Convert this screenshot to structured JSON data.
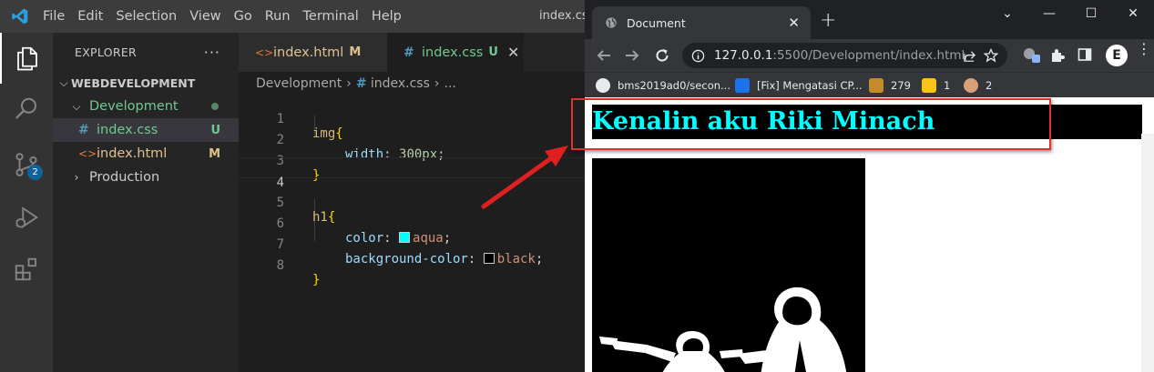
{
  "vscode": {
    "menu": [
      "File",
      "Edit",
      "Selection",
      "View",
      "Go",
      "Run",
      "Terminal",
      "Help"
    ],
    "window_title": "index.cs",
    "scm_badge": "2",
    "explorer": {
      "header": "EXPLORER",
      "more": "···",
      "root": "WEBDEVELOPMENT",
      "items": [
        {
          "label": "Development",
          "status": ""
        },
        {
          "label": "index.css",
          "status": "U"
        },
        {
          "label": "index.html",
          "status": "M"
        },
        {
          "label": "Production",
          "status": ""
        }
      ]
    },
    "tabs": [
      {
        "label": "index.html",
        "status": "M"
      },
      {
        "label": "index.css",
        "status": "U"
      }
    ],
    "breadcrumb": [
      "Development",
      "index.css",
      "..."
    ],
    "code_lines": [
      {
        "n": "1"
      },
      {
        "n": "2"
      },
      {
        "n": "3"
      },
      {
        "n": "4"
      },
      {
        "n": "5"
      },
      {
        "n": "6"
      },
      {
        "n": "7"
      },
      {
        "n": "8"
      }
    ],
    "code": {
      "l1_sel": "img",
      "l1_brace": "{",
      "l2_prop": "width",
      "l2_colon": ": ",
      "l2_val": "300px",
      "l2_semi": ";",
      "l3_brace": "}",
      "l5_sel": "h1",
      "l5_brace": "{",
      "l6_prop": "color",
      "l6_colon": ": ",
      "l6_val": "aqua",
      "l6_semi": ";",
      "l7_prop": "background-color",
      "l7_colon": ": ",
      "l7_val": "black",
      "l7_semi": ";",
      "l8_brace": "}"
    },
    "colors": {
      "aqua": "#00ffff",
      "black": "#000000"
    }
  },
  "chrome": {
    "tab_title": "Document",
    "url_host": "127.0.0.1",
    "url_rest": ":5500/Development/index.html",
    "profile_initial": "E",
    "bookmarks": [
      {
        "label": "bms2019ad0/secon..."
      },
      {
        "label": "[Fix] Mengatasi CP..."
      },
      {
        "label": "279"
      },
      {
        "label": "1"
      },
      {
        "label": "2"
      }
    ],
    "page": {
      "heading": "Kenalin aku Riki Minach"
    }
  }
}
